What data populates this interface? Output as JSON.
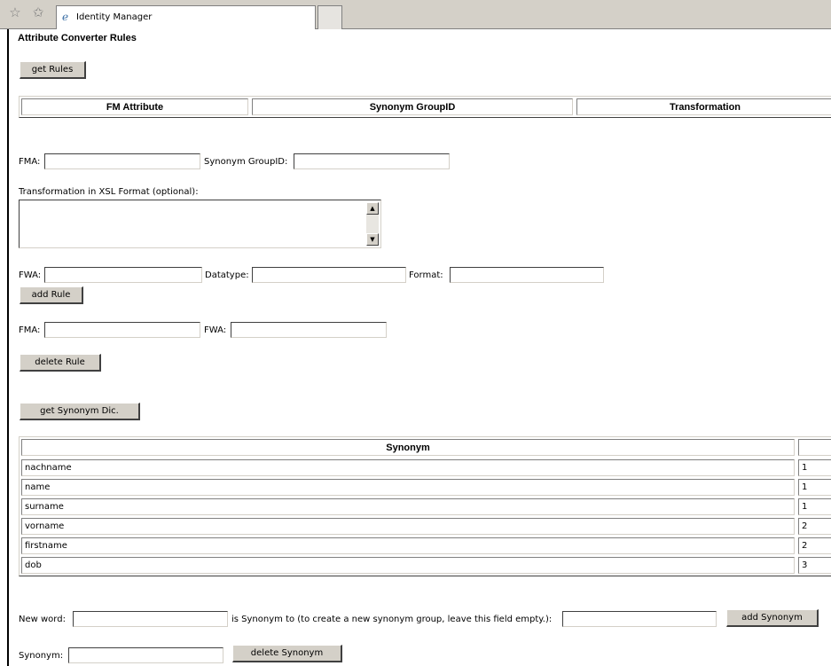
{
  "browser": {
    "tab_title": "Identity Manager",
    "icons": [
      "star-icon",
      "add-favorite-icon",
      "ie-page-icon"
    ]
  },
  "page": {
    "title": "Attribute Converter Rules",
    "get_rules_button": "get Rules",
    "rules_table_headers": [
      "FM Attribute",
      "Synonym GroupID",
      "Transformation"
    ],
    "fma_label": "FMA:",
    "synonym_groupid_label": "Synonym GroupID:",
    "transformation_label": "Transformation in XSL Format (optional):",
    "fwa_label": "FWA:",
    "datatype_label": "Datatype:",
    "format_label": "Format:",
    "add_rule_button": "add Rule",
    "delete_fma_label": "FMA:",
    "delete_fwa_label": "FWA:",
    "delete_rule_button": "delete Rule",
    "get_synonym_button": "get Synonym Dic.",
    "synonym_header": "Synonym",
    "synonyms": [
      {
        "word": "nachname",
        "group": "1"
      },
      {
        "word": "name",
        "group": "1"
      },
      {
        "word": "surname",
        "group": "1"
      },
      {
        "word": "vorname",
        "group": "2"
      },
      {
        "word": "firstname",
        "group": "2"
      },
      {
        "word": "dob",
        "group": "3"
      }
    ],
    "new_word_label": "New word:",
    "is_synonym_label": "is Synonym to (to create a new synonym group, leave this field empty.):",
    "add_synonym_button": "add Synonym",
    "synonym_label": "Synonym:",
    "delete_synonym_button": "delete Synonym"
  }
}
